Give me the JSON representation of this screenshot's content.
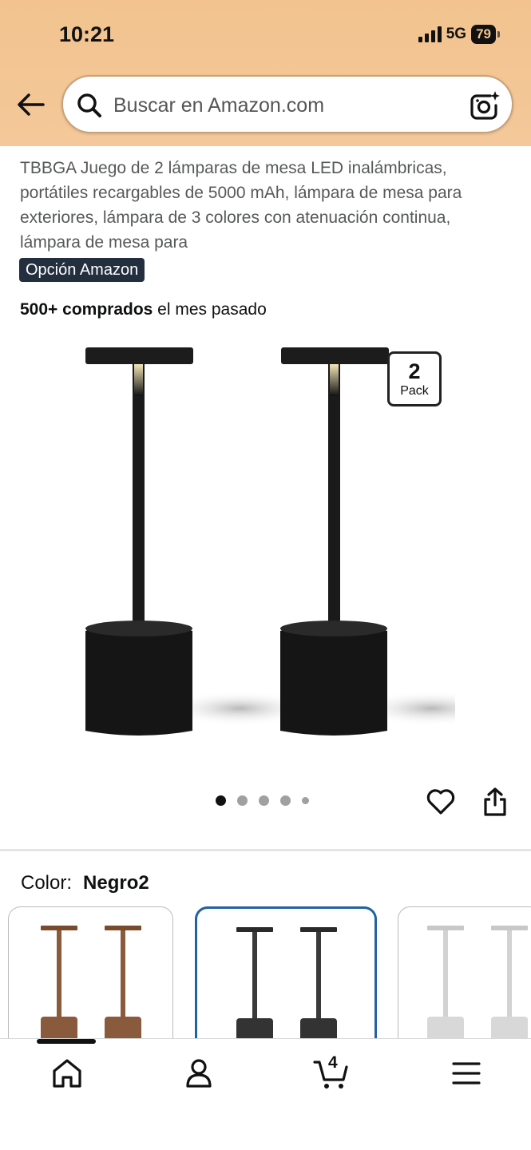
{
  "status": {
    "time": "10:21",
    "network": "5G",
    "battery": "79"
  },
  "search": {
    "placeholder": "Buscar en Amazon.com"
  },
  "product": {
    "title": "TBBGA Juego de 2 lámparas de mesa LED inalámbricas, portátiles recargables de 5000 mAh, lámpara de mesa para exteriores, lámpara de 3 colores con atenuación continua, lámpara de mesa para",
    "badge": "Opción Amazon",
    "bought_bold": "500+ comprados",
    "bought_rest": " el mes pasado",
    "pack_number": "2",
    "pack_label": "Pack",
    "image_count": 5,
    "active_image": 1
  },
  "color": {
    "label": "Color:",
    "value": "Negro2",
    "options": [
      {
        "name": "bronze",
        "hex": "#8a5a3c"
      },
      {
        "name": "black",
        "hex": "#3a3a3a"
      },
      {
        "name": "silver",
        "hex": "#d2d2d2"
      }
    ]
  },
  "nav": {
    "cart_count": "4"
  },
  "colors": {
    "header": "#f2c38e",
    "badge": "#232f3e",
    "selected_border": "#2162a1"
  }
}
